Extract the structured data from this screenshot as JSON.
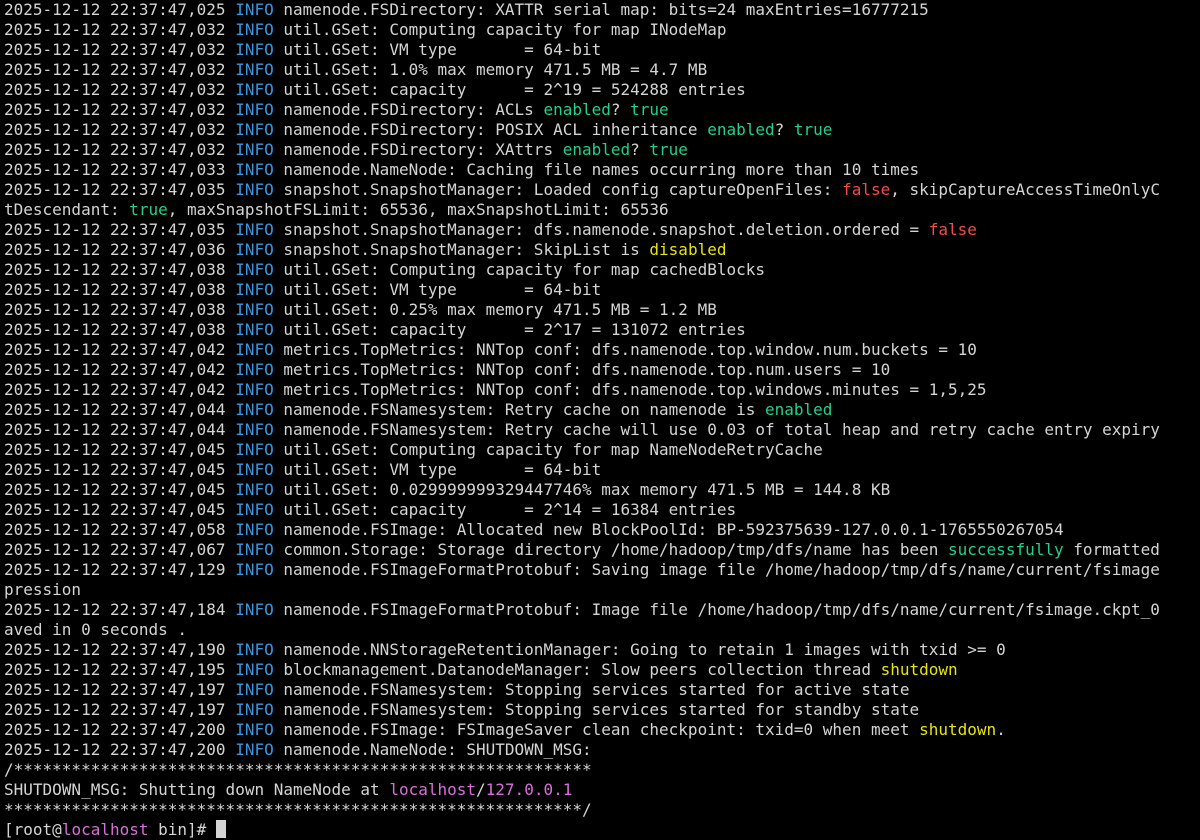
{
  "terminal": {
    "colors": {
      "background": "#000000",
      "default": "#d4d4d4",
      "info": "#3a96dd",
      "green": "#23d18b",
      "red": "#f14c4c",
      "yellow": "#e5e510",
      "magenta": "#d670d6"
    },
    "lines": [
      [
        {
          "t": "2025-12-12 22:37:47,025 "
        },
        {
          "t": "INFO",
          "c": "info"
        },
        {
          "t": " namenode.FSDirectory: XATTR serial map: bits=24 maxEntries=16777215"
        }
      ],
      [
        {
          "t": "2025-12-12 22:37:47,032 "
        },
        {
          "t": "INFO",
          "c": "info"
        },
        {
          "t": " util.GSet: Computing capacity for map INodeMap"
        }
      ],
      [
        {
          "t": "2025-12-12 22:37:47,032 "
        },
        {
          "t": "INFO",
          "c": "info"
        },
        {
          "t": " util.GSet: VM type       = 64-bit"
        }
      ],
      [
        {
          "t": "2025-12-12 22:37:47,032 "
        },
        {
          "t": "INFO",
          "c": "info"
        },
        {
          "t": " util.GSet: 1.0% max memory 471.5 MB = 4.7 MB"
        }
      ],
      [
        {
          "t": "2025-12-12 22:37:47,032 "
        },
        {
          "t": "INFO",
          "c": "info"
        },
        {
          "t": " util.GSet: capacity      = 2^19 = 524288 entries"
        }
      ],
      [
        {
          "t": "2025-12-12 22:37:47,032 "
        },
        {
          "t": "INFO",
          "c": "info"
        },
        {
          "t": " namenode.FSDirectory: ACLs "
        },
        {
          "t": "enabled",
          "c": "green"
        },
        {
          "t": "? "
        },
        {
          "t": "true",
          "c": "green"
        }
      ],
      [
        {
          "t": "2025-12-12 22:37:47,032 "
        },
        {
          "t": "INFO",
          "c": "info"
        },
        {
          "t": " namenode.FSDirectory: POSIX ACL inheritance "
        },
        {
          "t": "enabled",
          "c": "green"
        },
        {
          "t": "? "
        },
        {
          "t": "true",
          "c": "green"
        }
      ],
      [
        {
          "t": "2025-12-12 22:37:47,032 "
        },
        {
          "t": "INFO",
          "c": "info"
        },
        {
          "t": " namenode.FSDirectory: XAttrs "
        },
        {
          "t": "enabled",
          "c": "green"
        },
        {
          "t": "? "
        },
        {
          "t": "true",
          "c": "green"
        }
      ],
      [
        {
          "t": "2025-12-12 22:37:47,033 "
        },
        {
          "t": "INFO",
          "c": "info"
        },
        {
          "t": " namenode.NameNode: Caching file names occurring more than 10 times"
        }
      ],
      [
        {
          "t": "2025-12-12 22:37:47,035 "
        },
        {
          "t": "INFO",
          "c": "info"
        },
        {
          "t": " snapshot.SnapshotManager: Loaded config captureOpenFiles: "
        },
        {
          "t": "false",
          "c": "red"
        },
        {
          "t": ", skipCaptureAccessTimeOnlyC"
        }
      ],
      [
        {
          "t": "tDescendant: "
        },
        {
          "t": "true",
          "c": "green"
        },
        {
          "t": ", maxSnapshotFSLimit: 65536, maxSnapshotLimit: 65536"
        }
      ],
      [
        {
          "t": "2025-12-12 22:37:47,035 "
        },
        {
          "t": "INFO",
          "c": "info"
        },
        {
          "t": " snapshot.SnapshotManager: dfs.namenode.snapshot.deletion.ordered = "
        },
        {
          "t": "false",
          "c": "red"
        }
      ],
      [
        {
          "t": "2025-12-12 22:37:47,036 "
        },
        {
          "t": "INFO",
          "c": "info"
        },
        {
          "t": " snapshot.SnapshotManager: SkipList is "
        },
        {
          "t": "disabled",
          "c": "yellow"
        }
      ],
      [
        {
          "t": "2025-12-12 22:37:47,038 "
        },
        {
          "t": "INFO",
          "c": "info"
        },
        {
          "t": " util.GSet: Computing capacity for map cachedBlocks"
        }
      ],
      [
        {
          "t": "2025-12-12 22:37:47,038 "
        },
        {
          "t": "INFO",
          "c": "info"
        },
        {
          "t": " util.GSet: VM type       = 64-bit"
        }
      ],
      [
        {
          "t": "2025-12-12 22:37:47,038 "
        },
        {
          "t": "INFO",
          "c": "info"
        },
        {
          "t": " util.GSet: 0.25% max memory 471.5 MB = 1.2 MB"
        }
      ],
      [
        {
          "t": "2025-12-12 22:37:47,038 "
        },
        {
          "t": "INFO",
          "c": "info"
        },
        {
          "t": " util.GSet: capacity      = 2^17 = 131072 entries"
        }
      ],
      [
        {
          "t": "2025-12-12 22:37:47,042 "
        },
        {
          "t": "INFO",
          "c": "info"
        },
        {
          "t": " metrics.TopMetrics: NNTop conf: dfs.namenode.top.window.num.buckets = 10"
        }
      ],
      [
        {
          "t": "2025-12-12 22:37:47,042 "
        },
        {
          "t": "INFO",
          "c": "info"
        },
        {
          "t": " metrics.TopMetrics: NNTop conf: dfs.namenode.top.num.users = 10"
        }
      ],
      [
        {
          "t": "2025-12-12 22:37:47,042 "
        },
        {
          "t": "INFO",
          "c": "info"
        },
        {
          "t": " metrics.TopMetrics: NNTop conf: dfs.namenode.top.windows.minutes = 1,5,25"
        }
      ],
      [
        {
          "t": "2025-12-12 22:37:47,044 "
        },
        {
          "t": "INFO",
          "c": "info"
        },
        {
          "t": " namenode.FSNamesystem: Retry cache on namenode is "
        },
        {
          "t": "enabled",
          "c": "green"
        }
      ],
      [
        {
          "t": "2025-12-12 22:37:47,044 "
        },
        {
          "t": "INFO",
          "c": "info"
        },
        {
          "t": " namenode.FSNamesystem: Retry cache will use 0.03 of total heap and retry cache entry expiry"
        }
      ],
      [
        {
          "t": "2025-12-12 22:37:47,045 "
        },
        {
          "t": "INFO",
          "c": "info"
        },
        {
          "t": " util.GSet: Computing capacity for map NameNodeRetryCache"
        }
      ],
      [
        {
          "t": "2025-12-12 22:37:47,045 "
        },
        {
          "t": "INFO",
          "c": "info"
        },
        {
          "t": " util.GSet: VM type       = 64-bit"
        }
      ],
      [
        {
          "t": "2025-12-12 22:37:47,045 "
        },
        {
          "t": "INFO",
          "c": "info"
        },
        {
          "t": " util.GSet: 0.029999999329447746% max memory 471.5 MB = 144.8 KB"
        }
      ],
      [
        {
          "t": "2025-12-12 22:37:47,045 "
        },
        {
          "t": "INFO",
          "c": "info"
        },
        {
          "t": " util.GSet: capacity      = 2^14 = 16384 entries"
        }
      ],
      [
        {
          "t": "2025-12-12 22:37:47,058 "
        },
        {
          "t": "INFO",
          "c": "info"
        },
        {
          "t": " namenode.FSImage: Allocated new BlockPoolId: BP-592375639-127.0.0.1-1765550267054"
        }
      ],
      [
        {
          "t": "2025-12-12 22:37:47,067 "
        },
        {
          "t": "INFO",
          "c": "info"
        },
        {
          "t": " common.Storage: Storage directory /home/hadoop/tmp/dfs/name has been "
        },
        {
          "t": "successfully",
          "c": "green"
        },
        {
          "t": " formatted"
        }
      ],
      [
        {
          "t": "2025-12-12 22:37:47,129 "
        },
        {
          "t": "INFO",
          "c": "info"
        },
        {
          "t": " namenode.FSImageFormatProtobuf: Saving image file /home/hadoop/tmp/dfs/name/current/fsimage"
        }
      ],
      [
        {
          "t": "pression"
        }
      ],
      [
        {
          "t": "2025-12-12 22:37:47,184 "
        },
        {
          "t": "INFO",
          "c": "info"
        },
        {
          "t": " namenode.FSImageFormatProtobuf: Image file /home/hadoop/tmp/dfs/name/current/fsimage.ckpt_0"
        }
      ],
      [
        {
          "t": "aved in 0 seconds ."
        }
      ],
      [
        {
          "t": "2025-12-12 22:37:47,190 "
        },
        {
          "t": "INFO",
          "c": "info"
        },
        {
          "t": " namenode.NNStorageRetentionManager: Going to retain 1 images with txid >= 0"
        }
      ],
      [
        {
          "t": "2025-12-12 22:37:47,195 "
        },
        {
          "t": "INFO",
          "c": "info"
        },
        {
          "t": " blockmanagement.DatanodeManager: Slow peers collection thread "
        },
        {
          "t": "shutdown",
          "c": "yellow"
        }
      ],
      [
        {
          "t": "2025-12-12 22:37:47,197 "
        },
        {
          "t": "INFO",
          "c": "info"
        },
        {
          "t": " namenode.FSNamesystem: Stopping services started for active state"
        }
      ],
      [
        {
          "t": "2025-12-12 22:37:47,197 "
        },
        {
          "t": "INFO",
          "c": "info"
        },
        {
          "t": " namenode.FSNamesystem: Stopping services started for standby state"
        }
      ],
      [
        {
          "t": "2025-12-12 22:37:47,200 "
        },
        {
          "t": "INFO",
          "c": "info"
        },
        {
          "t": " namenode.FSImage: FSImageSaver clean checkpoint: txid=0 when meet "
        },
        {
          "t": "shutdown",
          "c": "yellow"
        },
        {
          "t": "."
        }
      ],
      [
        {
          "t": "2025-12-12 22:37:47,200 "
        },
        {
          "t": "INFO",
          "c": "info"
        },
        {
          "t": " namenode.NameNode: SHUTDOWN_MSG:"
        }
      ],
      [
        {
          "t": "/************************************************************"
        }
      ],
      [
        {
          "t": "SHUTDOWN_MSG: Shutting down NameNode at "
        },
        {
          "t": "localhost",
          "c": "magenta"
        },
        {
          "t": "/"
        },
        {
          "t": "127.0.0.1",
          "c": "magenta"
        }
      ],
      [
        {
          "t": "************************************************************/"
        }
      ]
    ],
    "prompt": {
      "open": "[",
      "user": "root",
      "at": "@",
      "host": "localhost",
      "path": " bin",
      "close": "]# "
    }
  }
}
